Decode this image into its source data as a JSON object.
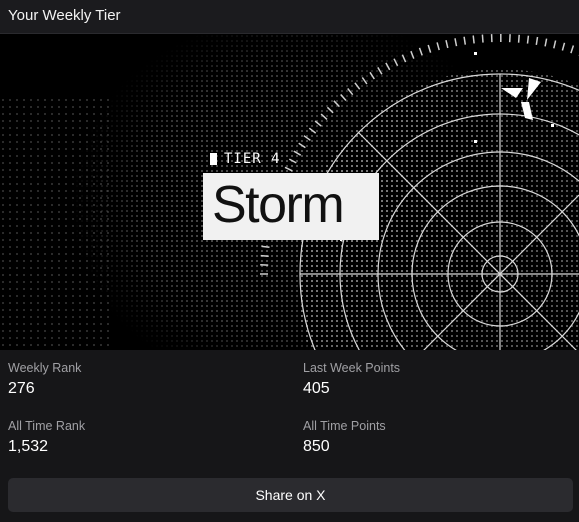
{
  "header": {
    "title": "Your Weekly Tier"
  },
  "tier": {
    "label": "TIER 4",
    "name": "Storm"
  },
  "stats": [
    {
      "label": "Weekly Rank",
      "value": "276"
    },
    {
      "label": "Last Week Points",
      "value": "405"
    },
    {
      "label": "All Time Rank",
      "value": "1,532"
    },
    {
      "label": "All Time Points",
      "value": "850"
    }
  ],
  "share": {
    "label": "Share on X"
  },
  "icons": {
    "logo": "tri-blade-logo-icon",
    "tier_marker": "square-icon"
  }
}
